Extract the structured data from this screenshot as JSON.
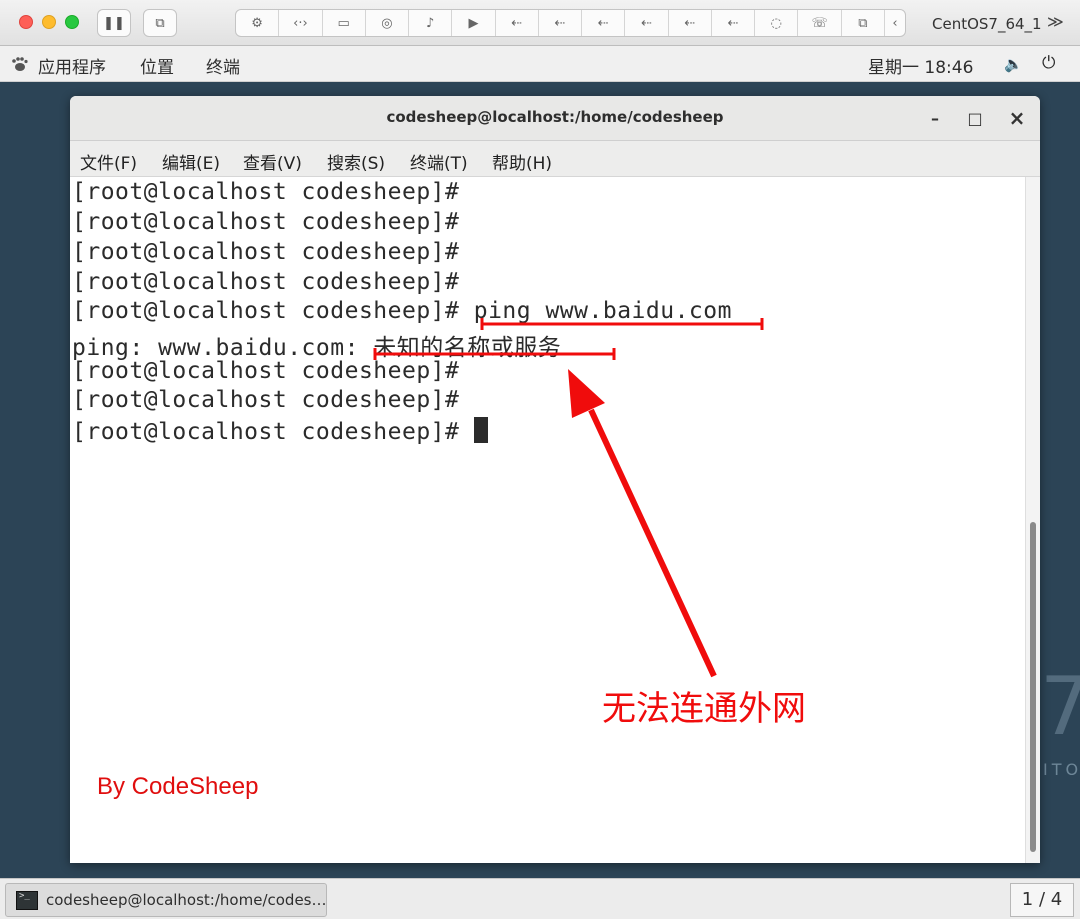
{
  "vm": {
    "name": "CentOS7_64_1",
    "more_glyph": "≫",
    "pause_glyph": "❚❚",
    "snapshot_glyph": "⧉",
    "devices": [
      "⚙",
      "‹·›",
      "▭",
      "◎",
      "♪",
      "▶",
      "⇠",
      "⇠",
      "⇠",
      "⇠",
      "⇠",
      "⇠",
      "◌",
      "☏",
      "⧉",
      "‹"
    ]
  },
  "gnome": {
    "apps": "应用程序",
    "places": "位置",
    "terminal": "终端",
    "clock": "星期一 18:46",
    "volume_glyph": "🔈",
    "power_glyph": "⏻"
  },
  "terminal": {
    "title": "codesheep@localhost:/home/codesheep",
    "minimize": "–",
    "maximize": "□",
    "close": "×",
    "menu": [
      "文件(F)",
      "编辑(E)",
      "查看(V)",
      "搜索(S)",
      "终端(T)",
      "帮助(H)"
    ],
    "lines": [
      "[root@localhost codesheep]#",
      "[root@localhost codesheep]#",
      "[root@localhost codesheep]#",
      "[root@localhost codesheep]#",
      "[root@localhost codesheep]# ping www.baidu.com",
      "ping: www.baidu.com: 未知的名称或服务",
      "[root@localhost codesheep]#",
      "[root@localhost codesheep]#",
      "[root@localhost codesheep]# "
    ]
  },
  "annotation": {
    "label": "无法连通外网",
    "brand": "By CodeSheep",
    "color": "#f00c0c"
  },
  "desktop": {
    "deco": "7",
    "deco2": "ITO"
  },
  "taskbar": {
    "window_label": "codesheep@localhost:/home/codes…",
    "workspace": "1 / 4"
  }
}
